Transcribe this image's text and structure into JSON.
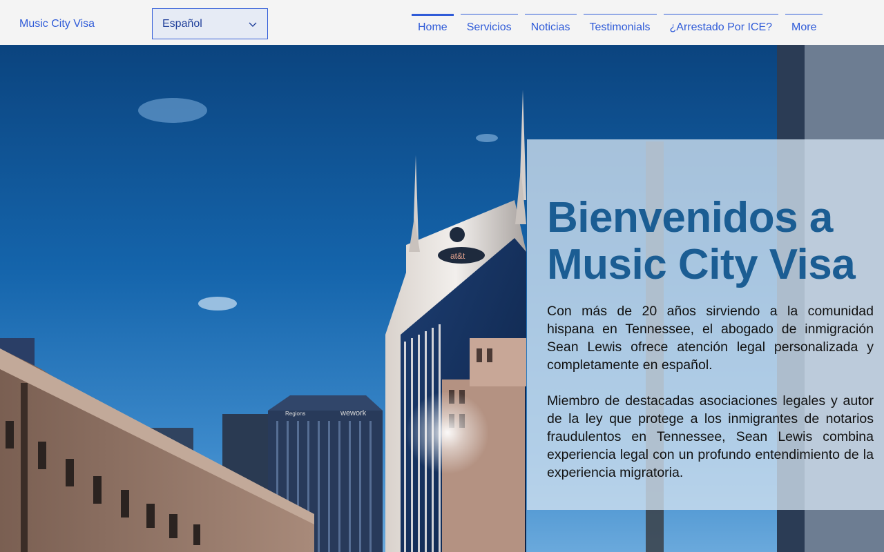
{
  "header": {
    "site_title": "Music City Visa",
    "language": {
      "selected": "Español"
    },
    "nav": [
      {
        "label": "Home",
        "active": true
      },
      {
        "label": "Servicios",
        "active": false
      },
      {
        "label": "Noticias",
        "active": false
      },
      {
        "label": "Testimonials",
        "active": false
      },
      {
        "label": "¿Arrestado Por ICE?",
        "active": false
      },
      {
        "label": "More",
        "active": false
      }
    ]
  },
  "hero": {
    "heading": "Bienvenidos a Music City Visa",
    "paragraph_1": "Con más de 20 años sirviendo a la comunidad hispana en Tennessee, el abogado de inmigración Sean Lewis ofrece atención legal personalizada y completamente en español.",
    "paragraph_2": "Miembro de destacadas asociaciones legales y autor de la ley que protege a los inmigrantes de notarios fraudulentos en Tennessee, Sean Lewis combina experiencia legal con un profundo entendimiento de la experiencia migratoria.",
    "sign_text_1": "at&t",
    "sign_text_2": "wework",
    "sign_text_3": "Regions"
  },
  "colors": {
    "accent": "#2f5bd8",
    "heading": "#1b5d93",
    "header_bg": "#f4f4f4"
  }
}
